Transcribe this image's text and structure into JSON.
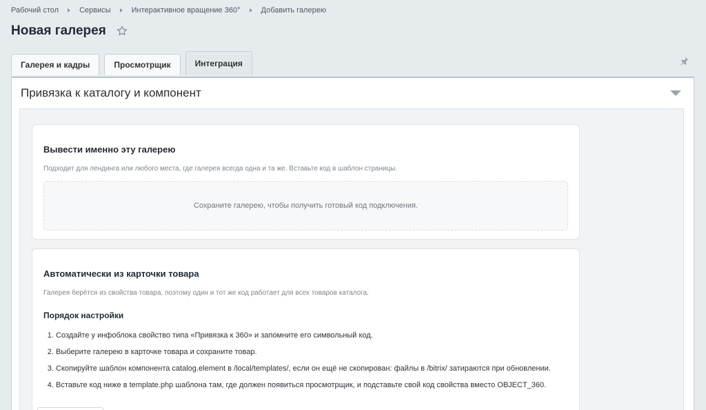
{
  "breadcrumb": {
    "items": [
      "Рабочий стол",
      "Сервисы",
      "Интерактивное вращение 360°",
      "Добавить галерею"
    ]
  },
  "page": {
    "title": "Новая галерея"
  },
  "tabs": [
    {
      "label": "Галерея и кадры"
    },
    {
      "label": "Просмотрщик"
    },
    {
      "label": "Интеграция",
      "active": true
    }
  ],
  "section": {
    "title": "Привязка к каталогу и компонент"
  },
  "cards": {
    "fixed": {
      "title": "Вывести именно эту галерею",
      "description": "Подходит для лендинга или любого места, где галерея всегда одна и та же. Вставьте код в шаблон страницы.",
      "placeholder": "Сохраните галерею, чтобы получить готовый код подключения."
    },
    "auto": {
      "title": "Автоматически из карточки товара",
      "description": "Галерея берётся из свойства товара, поэтому один и тот же код работает для всех товаров каталога.",
      "steps_title": "Порядок настройки",
      "steps": [
        "Создайте у инфоблока свойство типа «Привязка к 360» и запомните его символьный код.",
        "Выберите галерею в карточке товара и сохраните товар.",
        "Скопируйте шаблон компонента catalog.element в /local/templates/, если он ещё не скопирован: файлы в /bitrix/ затираются при обновлении.",
        "Вставьте код ниже в template.php шаблона там, где должен появиться просмотрщик, и подставьте свой код свойства вместо OBJECT_360."
      ]
    }
  },
  "icons": {
    "favorite": "star-icon",
    "pin": "pin-icon",
    "collapse": "chevron-down-icon"
  }
}
